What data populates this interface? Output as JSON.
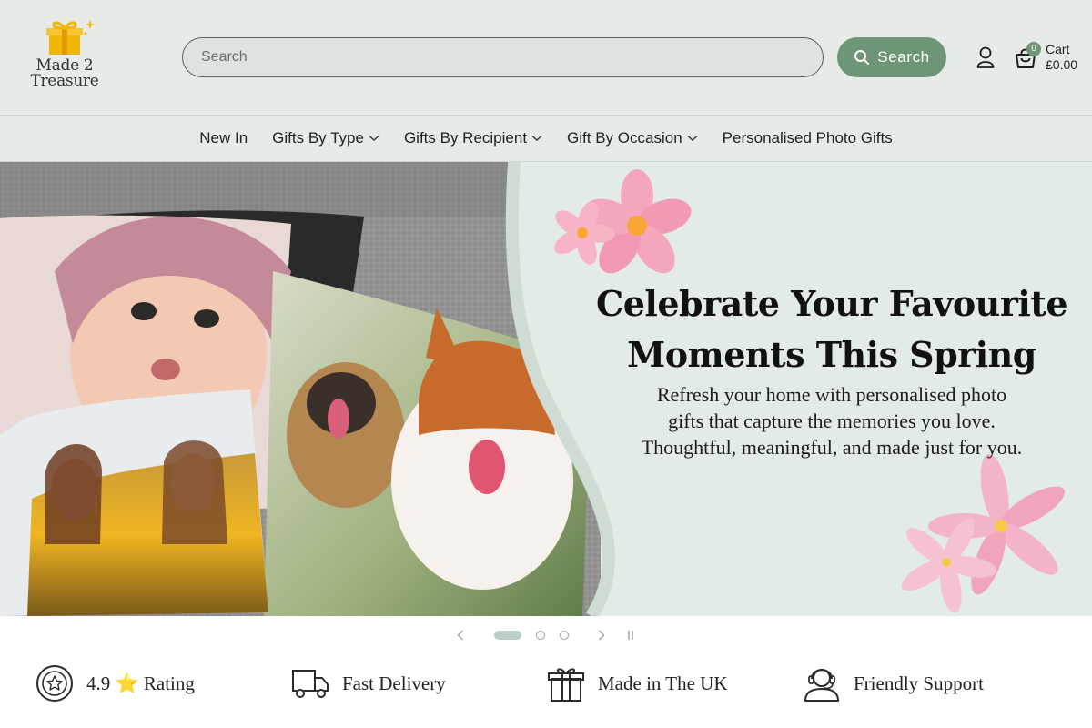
{
  "brand": {
    "logo_line1": "Made 2",
    "logo_line2": "Treasure",
    "logo_icon": "gift-icon"
  },
  "search": {
    "placeholder": "Search",
    "value": "",
    "button_label": "Search"
  },
  "account": {
    "icon": "user-icon"
  },
  "cart": {
    "label": "Cart",
    "total": "£0.00",
    "count": "0"
  },
  "nav": {
    "items": [
      {
        "label": "New In",
        "dropdown": false
      },
      {
        "label": "Gifts By Type",
        "dropdown": true
      },
      {
        "label": "Gifts By Recipient",
        "dropdown": true
      },
      {
        "label": "Gift By Occasion",
        "dropdown": true
      },
      {
        "label": "Personalised Photo Gifts",
        "dropdown": false
      }
    ]
  },
  "hero": {
    "title_line1": "Celebrate Your Favourite",
    "title_line2": "Moments This Spring",
    "sub_line1": "Refresh your home with personalised photo",
    "sub_line2": "gifts that capture the memories you love.",
    "sub_line3": "Thoughtful, meaningful, and made just for you."
  },
  "slider": {
    "slides": 3,
    "active": 1
  },
  "features": [
    {
      "icon": "rating-badge-icon",
      "text": "4.9 ⭐ Rating"
    },
    {
      "icon": "delivery-truck-icon",
      "text": "Fast Delivery"
    },
    {
      "icon": "gift-box-icon",
      "text": "Made in The UK"
    },
    {
      "icon": "support-agent-icon",
      "text": "Friendly Support"
    }
  ],
  "colors": {
    "header_bg": "#e6ebe8",
    "accent": "#6e9577",
    "hero_bg": "#e3ebe6",
    "logo_gold": "#f2b705"
  }
}
